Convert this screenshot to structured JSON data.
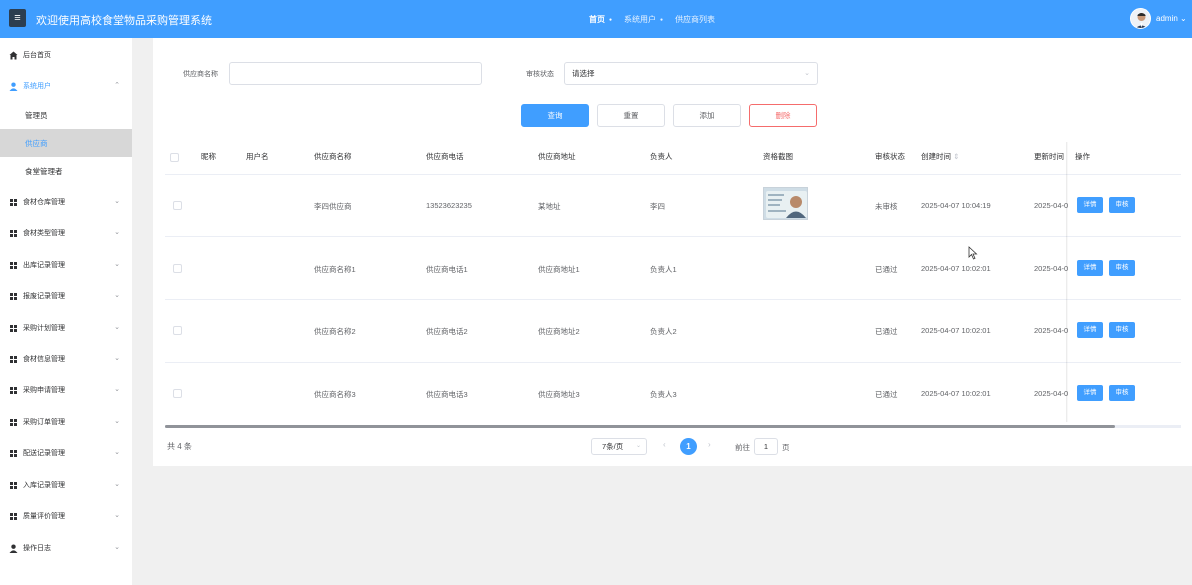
{
  "header": {
    "title": "欢迎使用高校食堂物品采购管理系统",
    "menu_icon": "menu-icon",
    "nav": [
      {
        "label": "首页",
        "active": true
      },
      {
        "label": "系统用户",
        "active": false
      },
      {
        "label": "供应商列表",
        "active": false
      }
    ],
    "user": "admin",
    "user_caret": "⌄",
    "accent": "#409eff"
  },
  "sidebar": {
    "items": [
      {
        "label": "后台首页",
        "icon": "home-icon"
      },
      {
        "label": "系统用户",
        "icon": "user-icon",
        "expanded": true,
        "children": [
          "管理员",
          "供应商",
          "食堂管理者"
        ],
        "active_child": "供应商"
      },
      {
        "label": "食材仓库管理",
        "icon": "grid-icon"
      },
      {
        "label": "食材类型管理",
        "icon": "grid-icon"
      },
      {
        "label": "出库记录管理",
        "icon": "grid-icon"
      },
      {
        "label": "报废记录管理",
        "icon": "grid-icon"
      },
      {
        "label": "采购计划管理",
        "icon": "grid-icon"
      },
      {
        "label": "食材信息管理",
        "icon": "grid-icon"
      },
      {
        "label": "采购申请管理",
        "icon": "grid-icon"
      },
      {
        "label": "采购订单管理",
        "icon": "grid-icon"
      },
      {
        "label": "配送记录管理",
        "icon": "grid-icon"
      },
      {
        "label": "入库记录管理",
        "icon": "grid-icon"
      },
      {
        "label": "质量评价管理",
        "icon": "grid-icon"
      },
      {
        "label": "操作日志",
        "icon": "user-icon"
      }
    ]
  },
  "filters": {
    "supplier_name_label": "供应商名称",
    "supplier_name_value": "",
    "status_label": "审核状态",
    "status_value": "请选择"
  },
  "buttons": {
    "query": "查询",
    "reset": "重置",
    "add": "添加",
    "delete": "删除"
  },
  "table": {
    "columns": [
      "昵称",
      "用户名",
      "供应商名称",
      "供应商电话",
      "供应商地址",
      "负责人",
      "资格截图",
      "审核状态",
      "创建时间",
      "更新时间",
      "操作"
    ],
    "sort_icon": "sort-icon",
    "rows": [
      {
        "nickname": "",
        "username": "",
        "name": "李四供应商",
        "phone": "13523623235",
        "address": "某地址",
        "contact": "李四",
        "has_image": true,
        "status": "未审核",
        "created": "2025-04-07 10:04:19",
        "updated": "2025-04-0"
      },
      {
        "nickname": "",
        "username": "",
        "name": "供应商名称1",
        "phone": "供应商电话1",
        "address": "供应商地址1",
        "contact": "负责人1",
        "has_image": false,
        "status": "已通过",
        "created": "2025-04-07 10:02:01",
        "updated": "2025-04-0"
      },
      {
        "nickname": "",
        "username": "",
        "name": "供应商名称2",
        "phone": "供应商电话2",
        "address": "供应商地址2",
        "contact": "负责人2",
        "has_image": false,
        "status": "已通过",
        "created": "2025-04-07 10:02:01",
        "updated": "2025-04-0"
      },
      {
        "nickname": "",
        "username": "",
        "name": "供应商名称3",
        "phone": "供应商电话3",
        "address": "供应商地址3",
        "contact": "负责人3",
        "has_image": false,
        "status": "已通过",
        "created": "2025-04-07 10:02:01",
        "updated": "2025-04-0"
      }
    ],
    "detail_label": "详情",
    "audit_label": "审核"
  },
  "pagination": {
    "total": "共 4 条",
    "page_size": "7条/页",
    "current_page": "1",
    "goto_prefix": "前往",
    "goto_value": "1",
    "goto_suffix": "页"
  }
}
